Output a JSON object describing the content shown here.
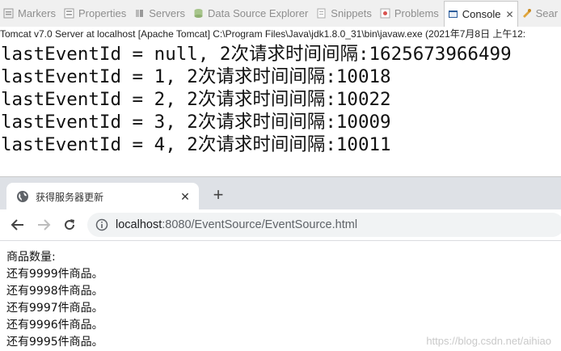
{
  "eclipse": {
    "tabs": [
      {
        "label": "Markers",
        "icon": "markers-icon"
      },
      {
        "label": "Properties",
        "icon": "properties-icon"
      },
      {
        "label": "Servers",
        "icon": "servers-icon"
      },
      {
        "label": "Data Source Explorer",
        "icon": "data-source-icon"
      },
      {
        "label": "Snippets",
        "icon": "snippets-icon"
      },
      {
        "label": "Problems",
        "icon": "problems-icon"
      },
      {
        "label": "Console",
        "icon": "console-icon",
        "active": true
      },
      {
        "label": "Sear",
        "icon": "search-icon"
      }
    ],
    "console_title": "Tomcat v7.0 Server at localhost [Apache Tomcat] C:\\Program Files\\Java\\jdk1.8.0_31\\bin\\javaw.exe (2021年7月8日 上午12:",
    "console_lines": [
      "lastEventId = null, 2次请求时间间隔:1625673966499",
      "lastEventId = 1, 2次请求时间间隔:10018",
      "lastEventId = 2, 2次请求时间间隔:10022",
      "lastEventId = 3, 2次请求时间间隔:10009",
      "lastEventId = 4, 2次请求时间间隔:10011"
    ]
  },
  "browser": {
    "tab_title": "获得服务器更新",
    "tab_close": "✕",
    "new_tab": "+",
    "url_host": "localhost",
    "url_rest": ":8080/EventSource/EventSource.html",
    "page_lines": [
      "商品数量:",
      "还有9999件商品。",
      "还有9998件商品。",
      "还有9997件商品。",
      "还有9996件商品。",
      "还有9995件商品。"
    ]
  },
  "watermark": "https://blog.csdn.net/aihiao"
}
